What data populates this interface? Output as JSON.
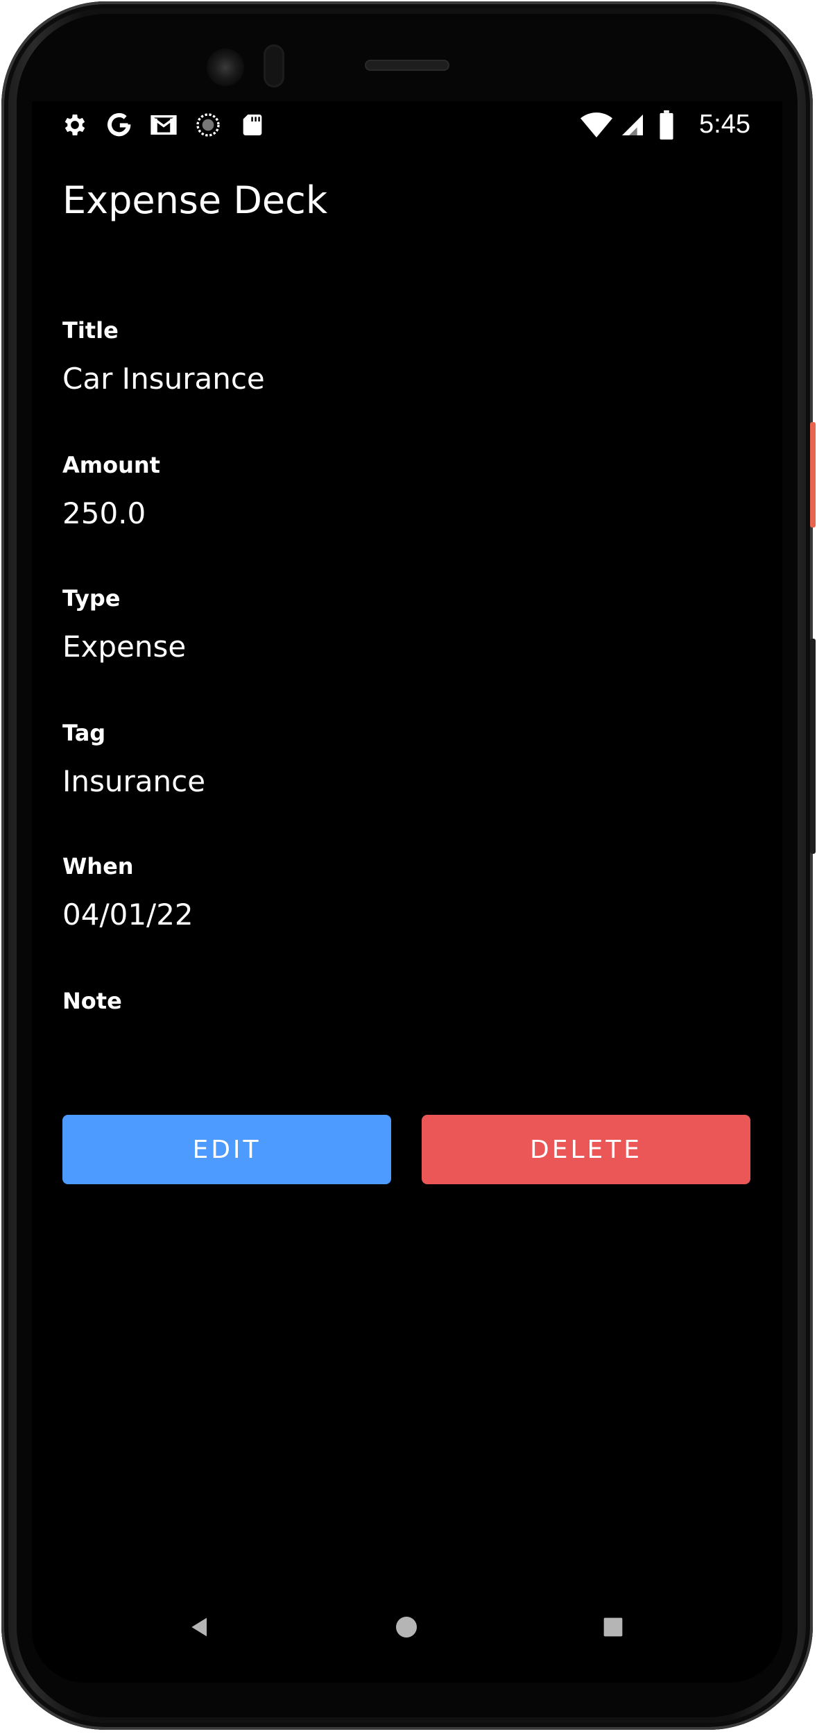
{
  "status_bar": {
    "time": "5:45",
    "left_icons": [
      "settings-icon",
      "google-icon",
      "gmail-icon",
      "sync-icon",
      "sd-card-icon"
    ],
    "right_icons": [
      "wifi-icon",
      "cellular-icon",
      "battery-icon"
    ]
  },
  "app": {
    "title": "Expense Deck"
  },
  "fields": {
    "title": {
      "label": "Title",
      "value": "Car Insurance"
    },
    "amount": {
      "label": "Amount",
      "value": "250.0"
    },
    "type": {
      "label": "Type",
      "value": "Expense"
    },
    "tag": {
      "label": "Tag",
      "value": "Insurance"
    },
    "when": {
      "label": "When",
      "value": "04/01/22"
    },
    "note": {
      "label": "Note",
      "value": ""
    }
  },
  "actions": {
    "edit_label": "EDIT",
    "delete_label": "DELETE"
  },
  "colors": {
    "background": "#000000",
    "text": "#ffffff",
    "edit_button": "#4d9bff",
    "delete_button": "#eb5757",
    "side_button_accent": "#e8664f"
  },
  "nav_bar": {
    "items": [
      "back-icon",
      "home-icon",
      "recents-icon"
    ]
  }
}
